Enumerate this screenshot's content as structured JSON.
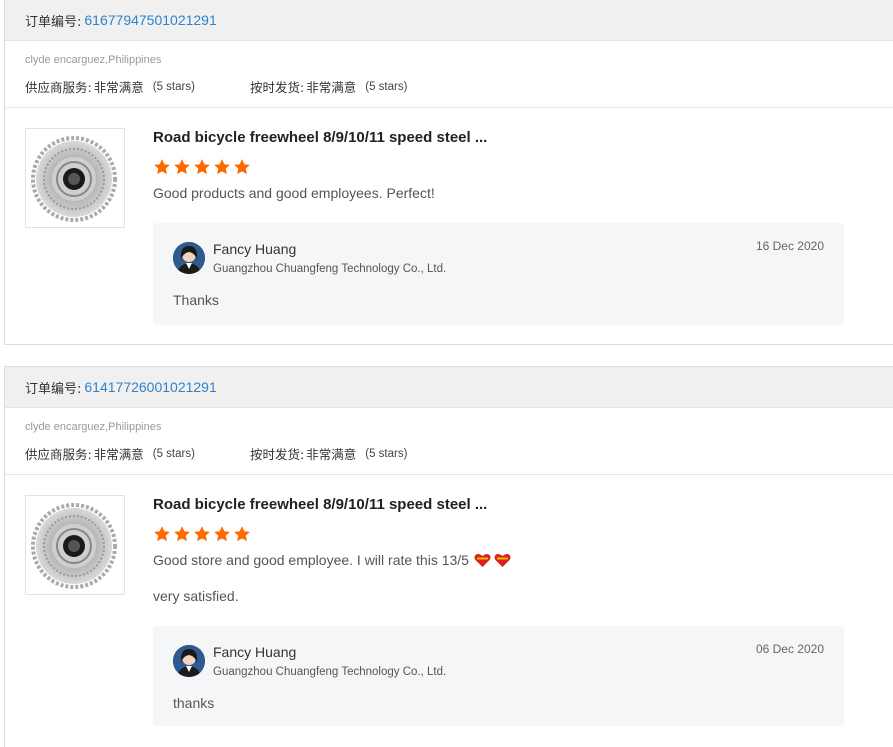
{
  "orders": [
    {
      "order_label": "订单编号:",
      "order_number": "61677947501021291",
      "buyer": "clyde encarguez,Philippines",
      "seller_service_label": "供应商服务:",
      "seller_service_value": "非常满意",
      "seller_service_stars": "(5 stars)",
      "shipping_label": "按时发货:",
      "shipping_value": "非常满意",
      "shipping_stars": "(5 stars)",
      "product_title": "Road bicycle freewheel 8/9/10/11 speed steel ...",
      "product_rating": 5,
      "feedback": "Good products and good employees. Perfect!",
      "feedback_extra": "",
      "reply": {
        "name": "Fancy Huang",
        "company": "Guangzhou Chuangfeng Technology Co., Ltd.",
        "date": "16 Dec 2020",
        "text": "Thanks"
      }
    },
    {
      "order_label": "订单编号:",
      "order_number": "61417726001021291",
      "buyer": "clyde encarguez,Philippines",
      "seller_service_label": "供应商服务:",
      "seller_service_value": "非常满意",
      "seller_service_stars": "(5 stars)",
      "shipping_label": "按时发货:",
      "shipping_value": "非常满意",
      "shipping_stars": "(5 stars)",
      "product_title": "Road bicycle freewheel 8/9/10/11 speed steel ...",
      "product_rating": 5,
      "feedback": "Good store and good employee. I will rate this 13/5",
      "feedback_extra": "very satisfied.",
      "reply": {
        "name": "Fancy Huang",
        "company": "Guangzhou Chuangfeng Technology Co., Ltd.",
        "date": "06 Dec 2020",
        "text": "thanks"
      }
    }
  ],
  "colors": {
    "link": "#2f83c8",
    "star": "#ff6a00",
    "header_bg": "#f0f0f0",
    "reply_bg": "#f5f6f8"
  },
  "icons": {
    "star": "star-icon",
    "heart": "heart-icon",
    "product": "cassette-product-image",
    "avatar": "user-avatar"
  }
}
